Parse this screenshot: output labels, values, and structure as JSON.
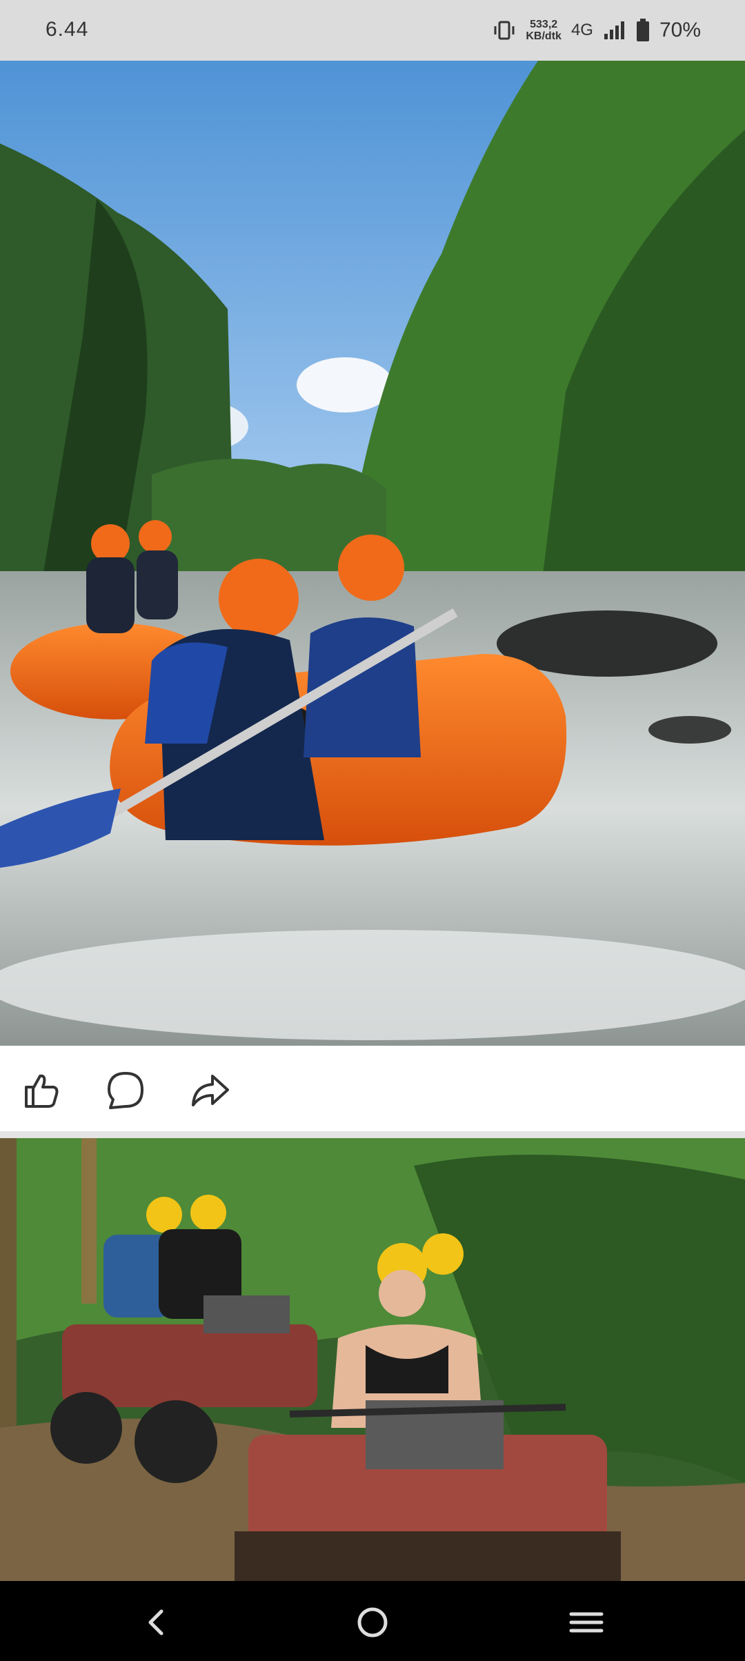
{
  "status_bar": {
    "time": "6.44",
    "net_speed_value": "533,2",
    "net_speed_unit": "KB/dtk",
    "network": "4G",
    "battery": "70%"
  },
  "post_1": {
    "image_icon": "river-rafting-photo",
    "actions": [
      "like-icon",
      "comment-icon",
      "share-icon"
    ]
  },
  "post_2": {
    "image_icon": "atv-jungle-photo"
  },
  "nav_bar": {
    "buttons": [
      "back-icon",
      "home-icon",
      "recent-apps-icon"
    ]
  }
}
